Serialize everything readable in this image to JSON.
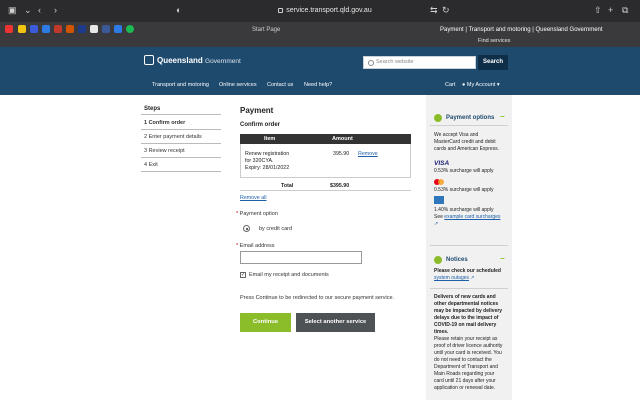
{
  "browser": {
    "url": "service.transport.qld.gov.au",
    "tabs": [
      "Start Page",
      "Payment | Transport and motoring | Queensland Government"
    ],
    "find_label": "Find services"
  },
  "header": {
    "logo_text": "Queensland",
    "logo_gov": "Government",
    "search_placeholder": "Search website",
    "search_button": "Search",
    "nav": [
      "Transport and motoring",
      "Online services",
      "Contact us",
      "Need help?"
    ],
    "cart": "Cart",
    "account": "My Account"
  },
  "steps": {
    "title": "Steps",
    "items": [
      "1  Confirm order",
      "2  Enter payment details",
      "3  Review receipt",
      "4  Exit"
    ]
  },
  "payment": {
    "title": "Payment",
    "subtitle": "Confirm order",
    "table_headers": [
      "Item",
      "Amount"
    ],
    "item_line1": "Renew registration",
    "item_line2": "for 320CYA.",
    "item_line3": "Expiry: 28/01/2022",
    "item_amount": "395.90",
    "remove": "Remove",
    "total_label": "Total",
    "total_value": "$395.90",
    "remove_all": "Remove all",
    "payment_option_label": "Payment option",
    "payment_option": "by credit card",
    "email_label": "Email address",
    "email_value": "",
    "email_checkbox_label": "Email my receipt and documents",
    "note": "Press Continue to be redirected to our secure payment service.",
    "continue_button": "Continue",
    "other_button": "Select another service"
  },
  "sidebar": {
    "payment_options_title": "Payment options",
    "accept_text": "We accept Visa and MasterCard credit and debit cards and American Express.",
    "visa_logo": "VISA",
    "visa_surcharge": "0.53% surcharge will apply",
    "mc_surcharge": "0.53% surcharge will apply",
    "amex_surcharge": "1.40% surcharge will apply",
    "see_text": "See",
    "see_link": "example card surcharges",
    "notices_title": "Notices",
    "notices_lead": "Please check our scheduled",
    "notices_link": "system outages",
    "notices_bold": "Delivers of new cards and other departmental notices may be impacted by delivery delays due to the impact of COVID-19 on mail delivery times.",
    "notices_body": "Please retain your receipt as proof of driver licence authority until your card is received. You do not need to contact the Department of Transport and Main Roads regarding your card until 21 days after your application or renewal date."
  }
}
